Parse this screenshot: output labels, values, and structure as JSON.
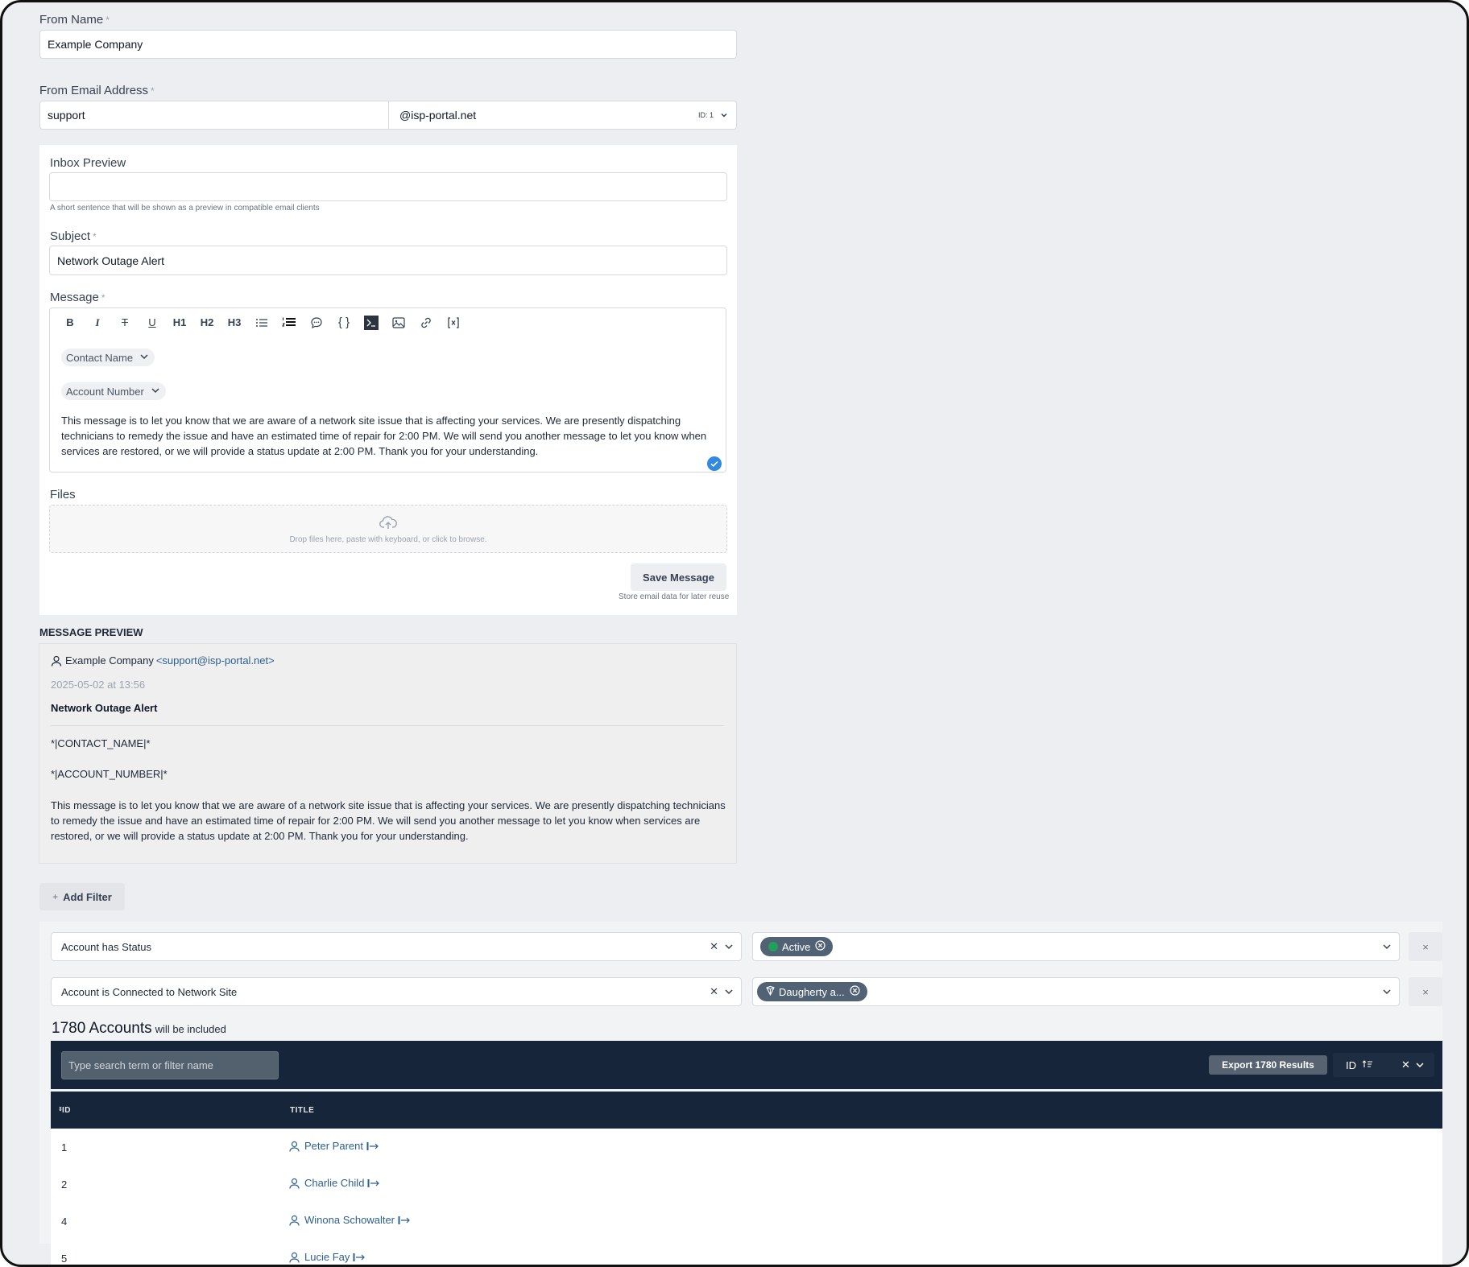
{
  "form": {
    "from_name_label": "From Name",
    "from_name_value": "Example Company",
    "from_email_label": "From Email Address",
    "email_user_value": "support",
    "email_domain_value": "@isp-portal.net",
    "email_domain_id": "ID: 1",
    "required_marker": "*"
  },
  "composer": {
    "inbox_preview_label": "Inbox Preview",
    "inbox_preview_value": "",
    "inbox_preview_hint": "A short sentence that will be shown as a preview in compatible email clients",
    "subject_label": "Subject",
    "subject_value": "Network Outage Alert",
    "message_label": "Message",
    "toolbar": {
      "bold": "B",
      "italic": "I",
      "strike": "T",
      "underline": "U",
      "h1": "H1",
      "h2": "H2",
      "h3": "H3",
      "code": "{ }"
    },
    "chip_contact": "Contact Name",
    "chip_account": "Account Number",
    "message_body": "This message is to let you know that we are aware of a network site issue that is affecting your services. We are presently dispatching technicians to remedy the issue and have an estimated time of repair for 2:00 PM. We will send you another message to let you know when services are restored, or we will provide a status update at 2:00 PM. Thank you for your understanding.",
    "files_label": "Files",
    "dropzone_text": "Drop files here, paste with keyboard, or click to browse.",
    "save_button": "Save Message",
    "save_hint": "Store email data for later reuse"
  },
  "preview": {
    "heading": "MESSAGE PREVIEW",
    "sender_name": "Example Company",
    "sender_email": "<support@isp-portal.net>",
    "timestamp": "2025-05-02 at 13:56",
    "subject": "Network Outage Alert",
    "merge_contact": "*|CONTACT_NAME|*",
    "merge_account": "*|ACCOUNT_NUMBER|*",
    "body": "This message is to let you know that we are aware of a network site issue that is affecting your services. We are presently dispatching technicians to remedy the issue and have an estimated time of repair for 2:00 PM. We will send you another message to let you know when services are restored, or we will provide a status update at 2:00 PM. Thank you for your understanding."
  },
  "filters": {
    "add_filter": "Add Filter",
    "add_icon": "+",
    "items": [
      {
        "field": "Account has Status",
        "value": "Active",
        "value_color": "#22a05b"
      },
      {
        "field": "Account is Connected to Network Site",
        "value": "Daugherty a..."
      }
    ],
    "remove_symbol": "×"
  },
  "results": {
    "count": "1780 Accounts",
    "suffix": "will be included",
    "search_placeholder": "Type search term or filter name",
    "export_button": "Export 1780 Results",
    "sort_field": "ID",
    "columns": [
      "ID",
      "TITLE"
    ],
    "rows": [
      {
        "id": "1",
        "title": "Peter Parent"
      },
      {
        "id": "2",
        "title": "Charlie Child"
      },
      {
        "id": "4",
        "title": "Winona Schowalter"
      },
      {
        "id": "5",
        "title": "Lucie Fay"
      }
    ]
  },
  "colors": {
    "accent": "#2b5f8e",
    "dark_header": "#17253a",
    "check_badge": "#2f8ae0"
  }
}
